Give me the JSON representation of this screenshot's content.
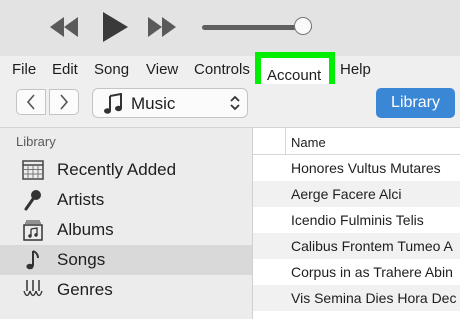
{
  "player": {
    "volume_level": 0.92
  },
  "menu": {
    "file": "File",
    "edit": "Edit",
    "song": "Song",
    "view": "View",
    "controls": "Controls",
    "account": "Account",
    "help": "Help",
    "highlight_color": "#00ee00"
  },
  "toolbar": {
    "media_kind": "Music",
    "library_button": "Library",
    "library_button_color": "#3a87d6"
  },
  "sidebar": {
    "title": "Library",
    "items": [
      {
        "label": "Recently Added",
        "icon": "calendar-grid-icon",
        "selected": false
      },
      {
        "label": "Artists",
        "icon": "microphone-icon",
        "selected": false
      },
      {
        "label": "Albums",
        "icon": "album-icon",
        "selected": false
      },
      {
        "label": "Songs",
        "icon": "music-note-icon",
        "selected": true
      },
      {
        "label": "Genres",
        "icon": "guitar-icon",
        "selected": false
      }
    ]
  },
  "songs": {
    "column_name": "Name",
    "rows": [
      "Honores Vultus Mutares",
      "Aerge Facere Alci",
      "Icendio Fulminis Telis",
      "Calibus Frontem Tumeo A",
      "Corpus in as Trahere Abin",
      "Vis Semina Dies Hora Dec"
    ]
  }
}
